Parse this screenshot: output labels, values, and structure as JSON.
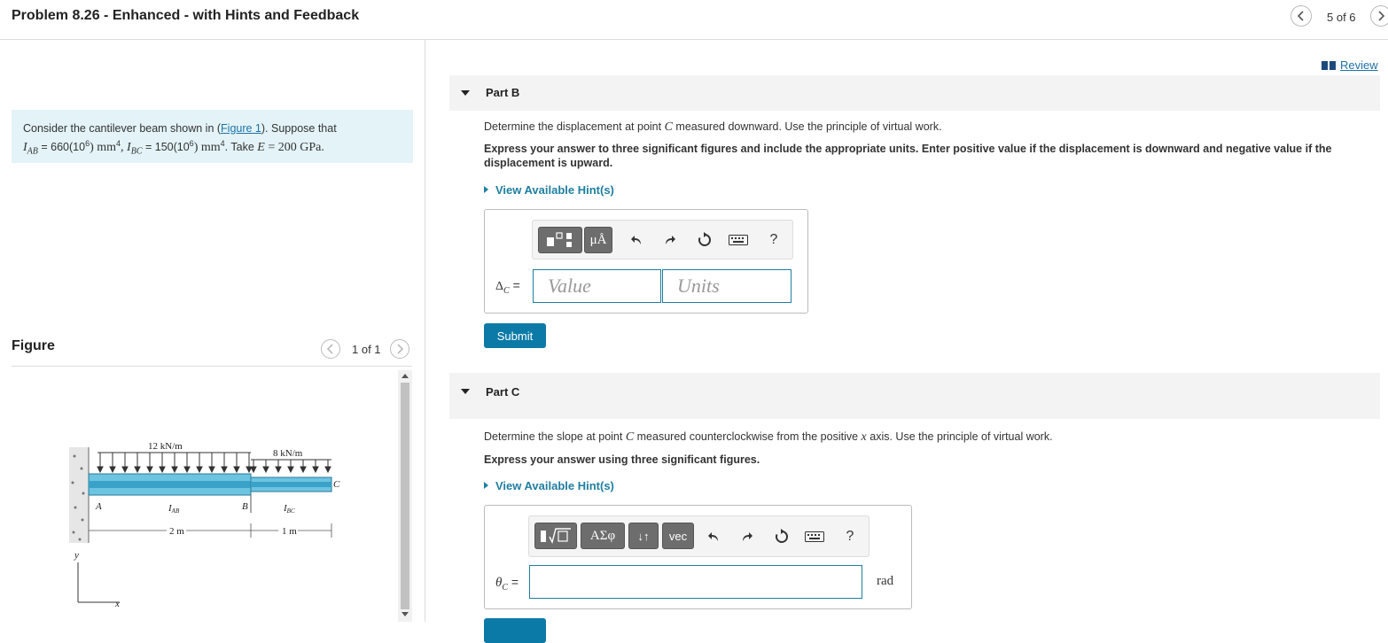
{
  "header": {
    "title": "Problem 8.26 - Enhanced - with Hints and Feedback",
    "pager": "5 of 6"
  },
  "problem": {
    "text_prefix": "Consider the cantilever beam shown in (",
    "figure_link": "Figure 1",
    "text_suffix": "). Suppose that",
    "line2": {
      "iab": "I",
      "iab_sub": "AB",
      "iab_val": " = 660(10",
      "iab_exp": "6",
      "iab_unit": ") mm",
      "iab_unit_exp": "4",
      "ibc": ", I",
      "ibc_sub": "BC",
      "ibc_val": " = 150(10",
      "ibc_exp": "6",
      "ibc_unit": ") mm",
      "ibc_unit_exp": "4",
      "take": ". Take ",
      "e": "E",
      "e_val": " = 200 GPa."
    }
  },
  "figure": {
    "label": "Figure",
    "pager": "1 of 1",
    "load_left": "12 kN/m",
    "load_right": "8 kN/m",
    "point_a": "A",
    "point_b": "B",
    "point_c": "C",
    "i_ab": "I",
    "i_ab_sub": "AB",
    "i_bc": "I",
    "i_bc_sub": "BC",
    "dim_ab": "2 m",
    "dim_bc": "1 m",
    "axis_y": "y",
    "axis_x": "x"
  },
  "review": "Review",
  "part_b": {
    "title": "Part B",
    "question_pre": "Determine the displacement at point ",
    "question_var": "C",
    "question_post": " measured downward. Use the principle of virtual work.",
    "instructions": "Express your answer to three significant figures and include the appropriate units. Enter positive value if the displacement is downward and negative value if the displacement is upward.",
    "hint": "View Available Hint(s)",
    "toolbar_unit_btn": "μÅ",
    "help": "?",
    "label_main": "Δ",
    "label_sub": "C",
    "label_eq": " =",
    "value_placeholder": "Value",
    "units_placeholder": "Units",
    "submit": "Submit"
  },
  "part_c": {
    "title": "Part C",
    "question_pre": "Determine the slope at point ",
    "question_var": "C",
    "question_mid": " measured counterclockwise from the positive ",
    "question_var2": "x",
    "question_post": " axis. Use the principle of virtual work.",
    "instructions": "Express your answer using three significant figures.",
    "hint": "View Available Hint(s)",
    "greek_btn": "ΑΣφ",
    "arrows_btn": "↓↑",
    "vec_btn": "vec",
    "help": "?",
    "label_main": "θ",
    "label_sub": "C",
    "label_eq": " =",
    "unit": "rad"
  }
}
